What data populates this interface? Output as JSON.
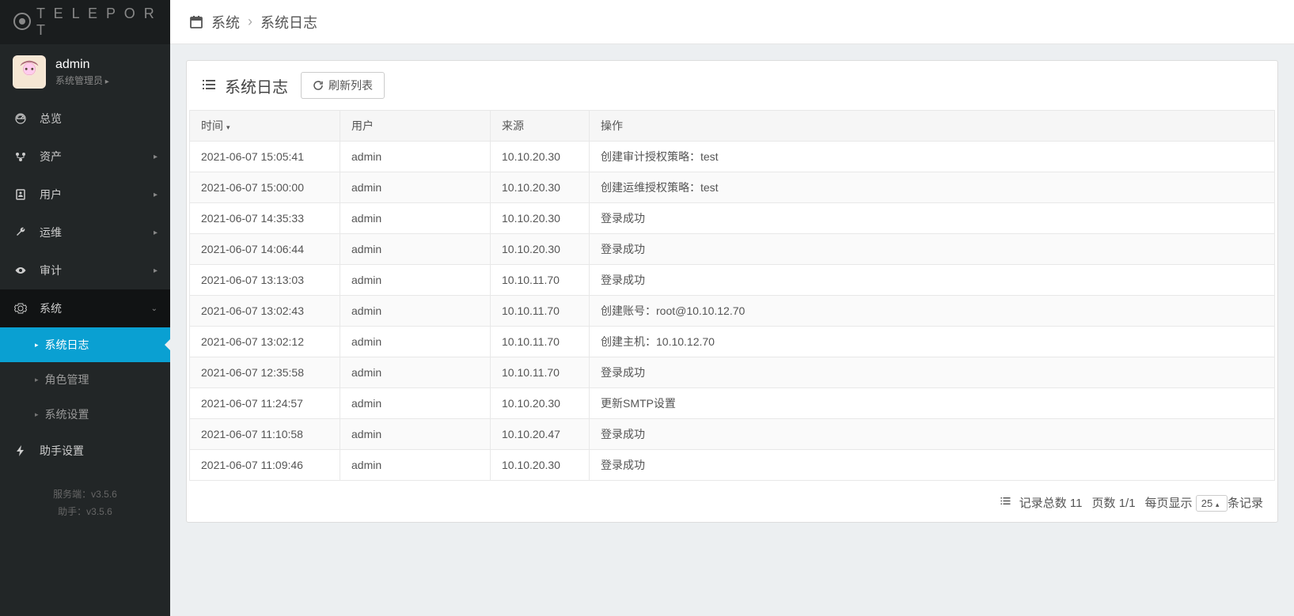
{
  "brand": "T E L E P O R T",
  "user": {
    "name": "admin",
    "role": "系统管理员"
  },
  "sidebar": {
    "items": [
      {
        "label": "总览"
      },
      {
        "label": "资产"
      },
      {
        "label": "用户"
      },
      {
        "label": "运维"
      },
      {
        "label": "审计"
      },
      {
        "label": "系统"
      },
      {
        "label": "助手设置"
      }
    ],
    "system_children": [
      {
        "label": "系统日志"
      },
      {
        "label": "角色管理"
      },
      {
        "label": "系统设置"
      }
    ]
  },
  "version": {
    "server_label": "服务端：",
    "server_value": "v3.5.6",
    "assist_label": "助手：",
    "assist_value": "v3.5.6"
  },
  "breadcrumb": {
    "root": "系统",
    "current": "系统日志"
  },
  "panel": {
    "title": "系统日志",
    "refresh_label": "刷新列表"
  },
  "table": {
    "headers": {
      "time": "时间",
      "user": "用户",
      "source": "来源",
      "action": "操作"
    },
    "rows": [
      {
        "time": "2021-06-07 15:05:41",
        "user": "admin",
        "source": "10.10.20.30",
        "action": "创建审计授权策略：test"
      },
      {
        "time": "2021-06-07 15:00:00",
        "user": "admin",
        "source": "10.10.20.30",
        "action": "创建运维授权策略：test"
      },
      {
        "time": "2021-06-07 14:35:33",
        "user": "admin",
        "source": "10.10.20.30",
        "action": "登录成功"
      },
      {
        "time": "2021-06-07 14:06:44",
        "user": "admin",
        "source": "10.10.20.30",
        "action": "登录成功"
      },
      {
        "time": "2021-06-07 13:13:03",
        "user": "admin",
        "source": "10.10.11.70",
        "action": "登录成功"
      },
      {
        "time": "2021-06-07 13:02:43",
        "user": "admin",
        "source": "10.10.11.70",
        "action": "创建账号：root@10.10.12.70"
      },
      {
        "time": "2021-06-07 13:02:12",
        "user": "admin",
        "source": "10.10.11.70",
        "action": "创建主机：10.10.12.70"
      },
      {
        "time": "2021-06-07 12:35:58",
        "user": "admin",
        "source": "10.10.11.70",
        "action": "登录成功"
      },
      {
        "time": "2021-06-07 11:24:57",
        "user": "admin",
        "source": "10.10.20.30",
        "action": "更新SMTP设置"
      },
      {
        "time": "2021-06-07 11:10:58",
        "user": "admin",
        "source": "10.10.20.47",
        "action": "登录成功"
      },
      {
        "time": "2021-06-07 11:09:46",
        "user": "admin",
        "source": "10.10.20.30",
        "action": "登录成功"
      }
    ]
  },
  "footer": {
    "total_label": "记录总数",
    "total_value": "11",
    "page_label": "页数",
    "page_value": "1/1",
    "perpage_label": "每页显示",
    "perpage_value": "25",
    "perpage_suffix": "条记录"
  }
}
